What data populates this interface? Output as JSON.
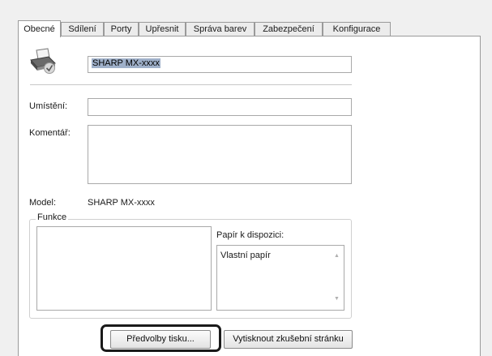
{
  "tabs": [
    "Obecné",
    "Sdílení",
    "Porty",
    "Upřesnit",
    "Správa barev",
    "Zabezpečení",
    "Konfigurace"
  ],
  "active_tab": "Obecné",
  "printer": {
    "icon": "printer-icon",
    "name": "SHARP MX-xxxx"
  },
  "fields": {
    "location_label": "Umístění:",
    "location_value": "",
    "comment_label": "Komentář:",
    "comment_value": ""
  },
  "model": {
    "label": "Model:",
    "value": "SHARP MX-xxxx"
  },
  "features": {
    "group_title": "Funkce",
    "paper_label": "Papír k dispozici:",
    "paper_items": [
      "Vlastní papír"
    ]
  },
  "buttons": {
    "preferences": "Předvolby tisku...",
    "test_page": "Vytisknout zkušební stránku"
  },
  "colors": {
    "highlight": "#1a1a1a",
    "selection": "#9fb0c9"
  }
}
